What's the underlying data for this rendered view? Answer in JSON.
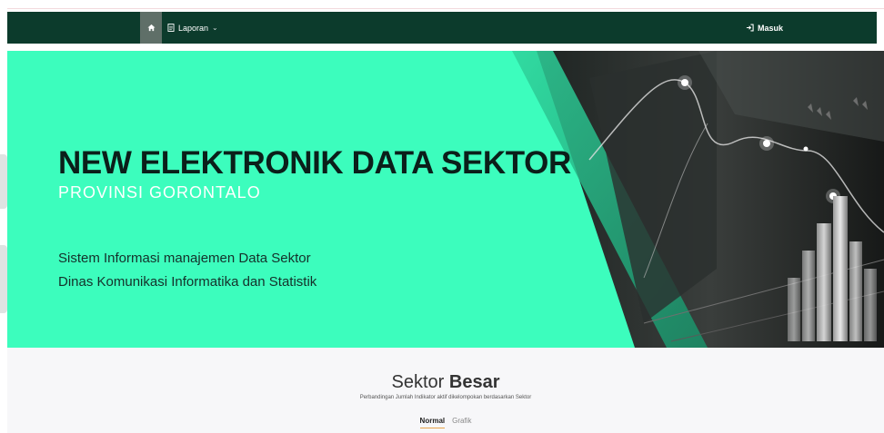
{
  "nav": {
    "home_icon": "home-icon",
    "laporan_icon": "document-icon",
    "laporan_label": "Laporan",
    "laporan_caret": "⌄",
    "masuk_icon": "login-icon",
    "masuk_label": "Masuk"
  },
  "hero": {
    "title": "NEW ELEKTRONIK DATA SEKTOR",
    "subtitle": "PROVINSI GORONTALO",
    "line1": "Sistem Informasi manajemen Data Sektor",
    "line2": "Dinas Komunikasi Informatika dan Statistik"
  },
  "section": {
    "title_normal": "Sektor ",
    "title_bold": "Besar",
    "description": "Perbandingan Jumlah Indikator aktif dikelompokan berdasarkan Sektor",
    "tabs": [
      "Normal",
      "Grafik"
    ]
  },
  "colors": {
    "navbar": "#0c3b2c",
    "hero_accent": "#3cfdbd",
    "tab_underline": "#e8a34a"
  }
}
